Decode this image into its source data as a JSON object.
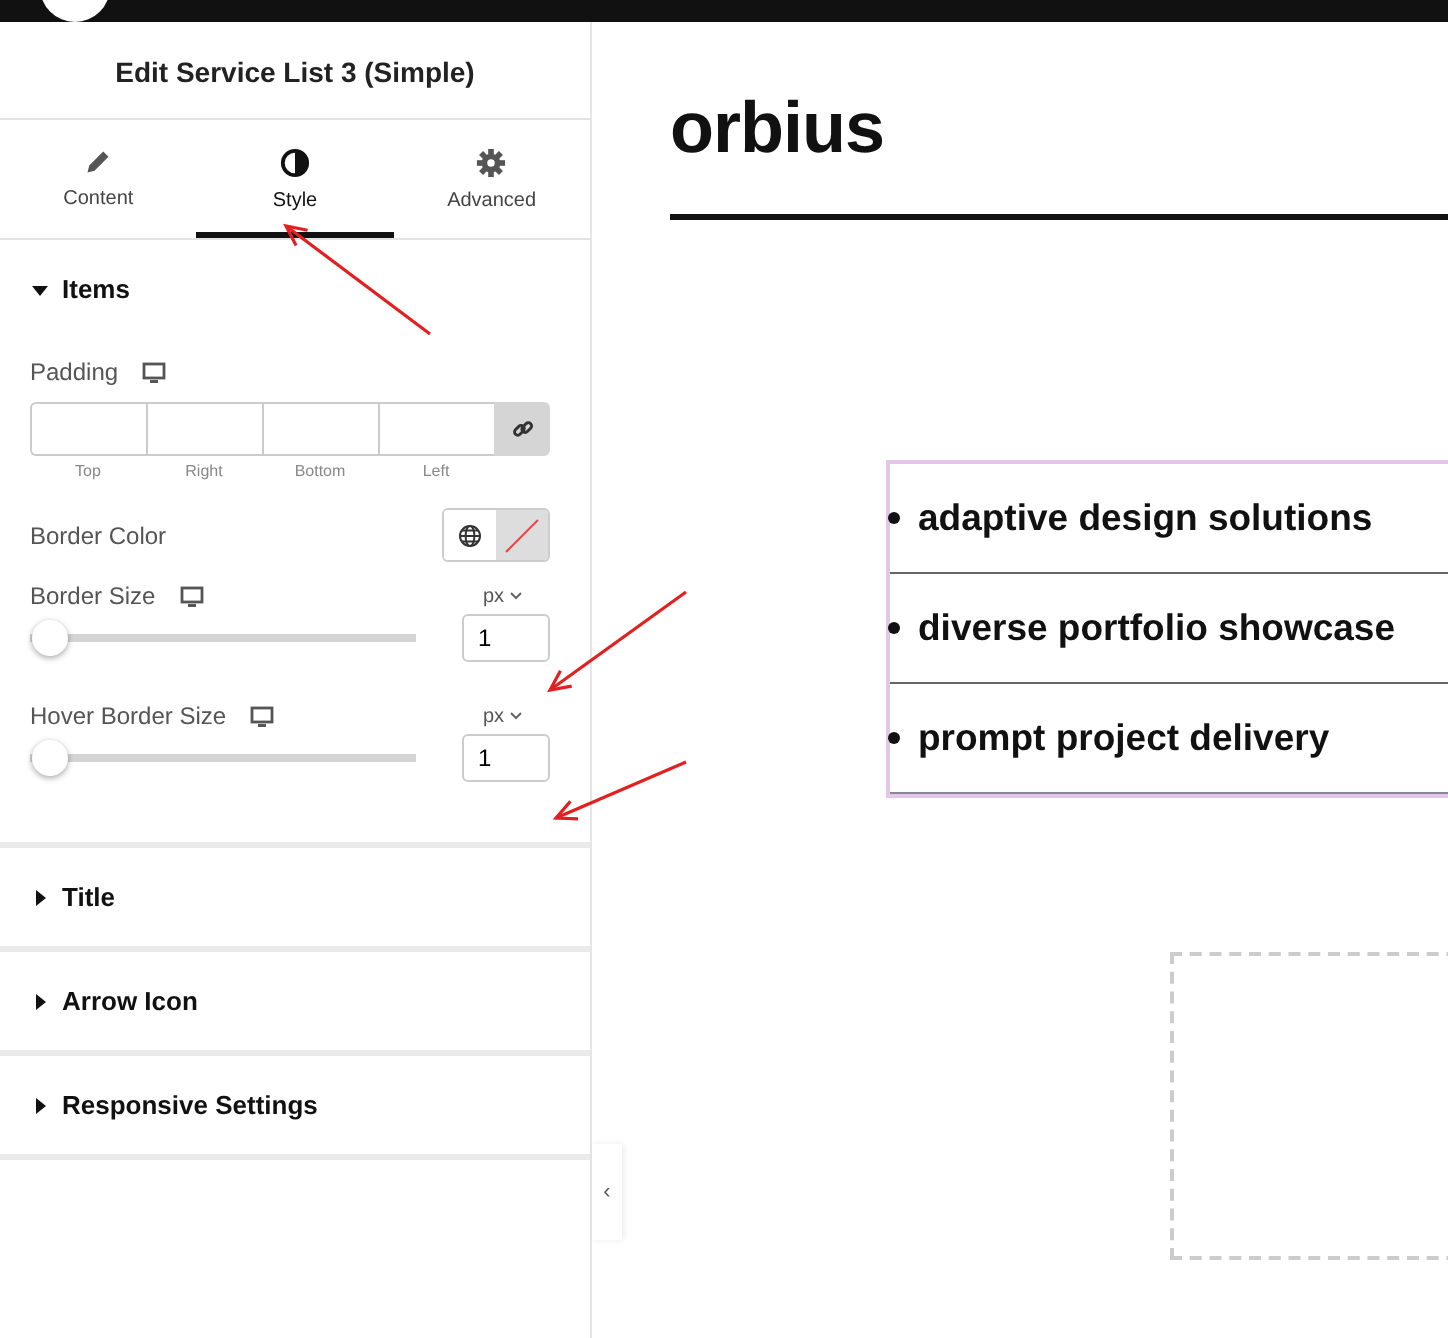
{
  "panel": {
    "title": "Edit Service List 3 (Simple)",
    "tabs": [
      {
        "label": "Content",
        "selected": false
      },
      {
        "label": "Style",
        "selected": true
      },
      {
        "label": "Advanced",
        "selected": false
      }
    ],
    "sections": [
      {
        "label": "Items",
        "expanded": true
      },
      {
        "label": "Title",
        "expanded": false
      },
      {
        "label": "Arrow Icon",
        "expanded": false
      },
      {
        "label": "Responsive Settings",
        "expanded": false
      }
    ],
    "padding": {
      "label": "Padding",
      "sides": [
        "Top",
        "Right",
        "Bottom",
        "Left"
      ]
    },
    "border_color": {
      "label": "Border Color"
    },
    "sliders": [
      {
        "label": "Border Size",
        "unit": "px",
        "level": 0.05,
        "value": "1"
      },
      {
        "label": "Hover Border Size",
        "unit": "px",
        "level": 0.05,
        "value": "1"
      }
    ],
    "collapse_handle": "‹"
  },
  "canvas": {
    "heading": "orbius",
    "items": [
      "adaptive design solutions",
      "diverse portfolio showcase",
      "prompt project delivery"
    ]
  }
}
